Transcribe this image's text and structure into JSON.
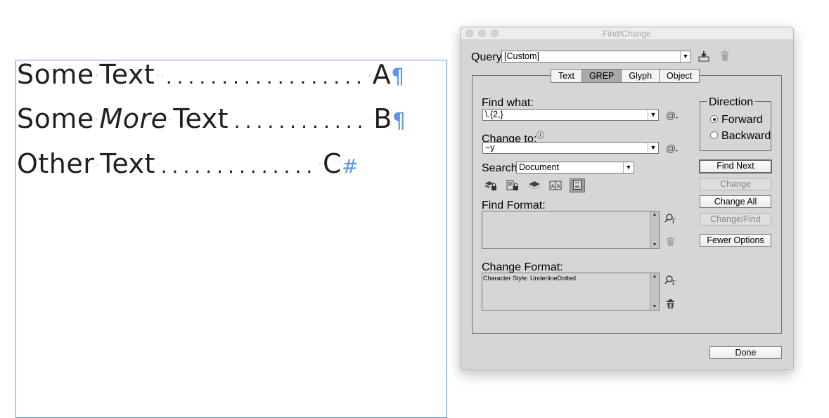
{
  "document": {
    "lines": [
      {
        "words": [
          "Some",
          "Text"
        ],
        "leader": "..................",
        "marker": "A",
        "end_mark": "¶"
      },
      {
        "words": [
          "Some",
          "More",
          "Text"
        ],
        "leader": "............",
        "marker": "B",
        "end_mark": "¶"
      },
      {
        "words": [
          "Other",
          "Text"
        ],
        "leader": "..............",
        "marker": "C",
        "end_mark": "#"
      }
    ],
    "space_mark": "·"
  },
  "dialog": {
    "title": "Find/Change",
    "query_label": "Query:",
    "query_value": "[Custom]",
    "query_icons": {
      "save": "save-query-icon",
      "delete": "delete-query-icon"
    },
    "tabs": [
      {
        "label": "Text",
        "active": false
      },
      {
        "label": "GREP",
        "active": true
      },
      {
        "label": "Glyph",
        "active": false
      },
      {
        "label": "Object",
        "active": false
      }
    ],
    "find_what_label": "Find what:",
    "find_what_value": "\\.{2,}",
    "change_to_label": "Change to:",
    "change_to_value": "~y",
    "special_char_icon": "@",
    "info_icon": "ⓘ",
    "search_label": "Search:",
    "search_value": "Document",
    "search_options": [
      {
        "icon": "include-locked-layers-icon",
        "glyph": "🔒",
        "active": false
      },
      {
        "icon": "include-locked-stories-icon",
        "glyph": "🔒",
        "active": false
      },
      {
        "icon": "include-hidden-layers-icon",
        "glyph": "◆",
        "active": false
      },
      {
        "icon": "include-master-pages-icon",
        "glyph": "A|A",
        "active": false
      },
      {
        "icon": "include-footnotes-icon",
        "glyph": "☰",
        "active": true
      }
    ],
    "direction": {
      "legend": "Direction",
      "options": [
        {
          "label": "Forward",
          "checked": true
        },
        {
          "label": "Backward",
          "checked": false
        }
      ]
    },
    "buttons": {
      "find_next": "Find Next",
      "change": "Change",
      "change_all": "Change All",
      "change_find": "Change/Find",
      "fewer_options": "Fewer Options",
      "done": "Done"
    },
    "find_format_label": "Find Format:",
    "find_format_value": "",
    "change_format_label": "Change Format:",
    "change_format_value": "Character Style: UnderlineDotted"
  }
}
